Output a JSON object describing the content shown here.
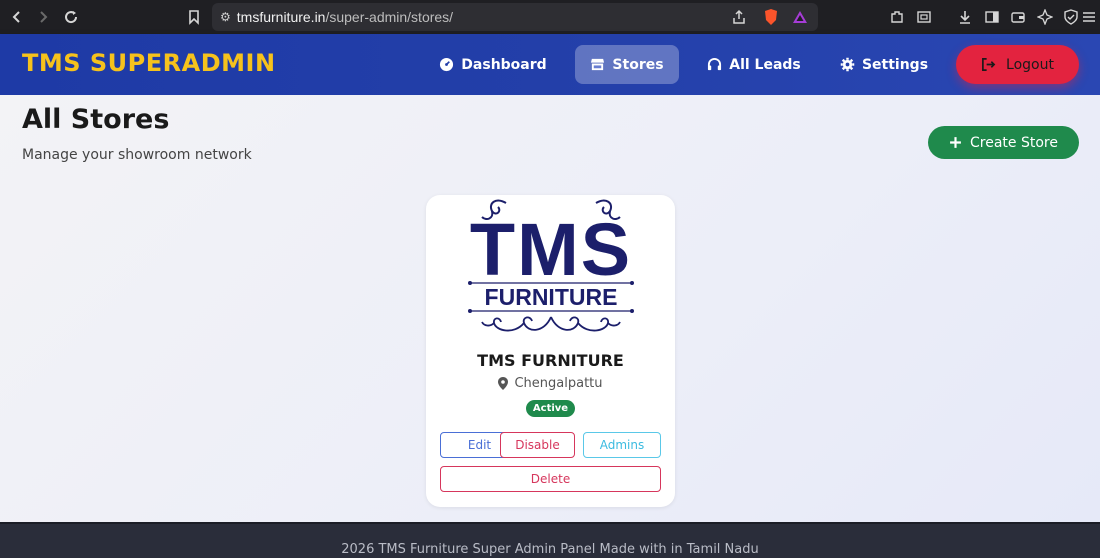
{
  "browser": {
    "url_domain": "tmsfurniture.in",
    "url_path": "/super-admin/stores/"
  },
  "navbar": {
    "brand": "TMS SUPERADMIN",
    "items": [
      {
        "label": "Dashboard",
        "icon": "gauge-icon"
      },
      {
        "label": "Stores",
        "icon": "store-icon",
        "active": true
      },
      {
        "label": "All Leads",
        "icon": "headset-icon"
      },
      {
        "label": "Settings",
        "icon": "gear-icon"
      }
    ],
    "logout_label": "Logout"
  },
  "page": {
    "title": "All Stores",
    "subtitle": "Manage your showroom network",
    "create_label": "Create Store"
  },
  "store": {
    "logo_text_top": "TMS",
    "logo_text_bottom": "FURNITURE",
    "name": "TMS FURNITURE",
    "location": "Chengalpattu",
    "status": "Active",
    "actions": {
      "edit": "Edit",
      "disable": "Disable",
      "admins": "Admins",
      "delete": "Delete"
    }
  },
  "footer": {
    "text": "2026 TMS Furniture Super Admin Panel Made with in Tamil Nadu"
  },
  "colors": {
    "brand_yellow": "#f6c21c",
    "nav_blue": "#233fa9",
    "logout_red": "#e3233f",
    "success_green": "#1f8a4c",
    "logo_navy": "#1c1f6b"
  }
}
